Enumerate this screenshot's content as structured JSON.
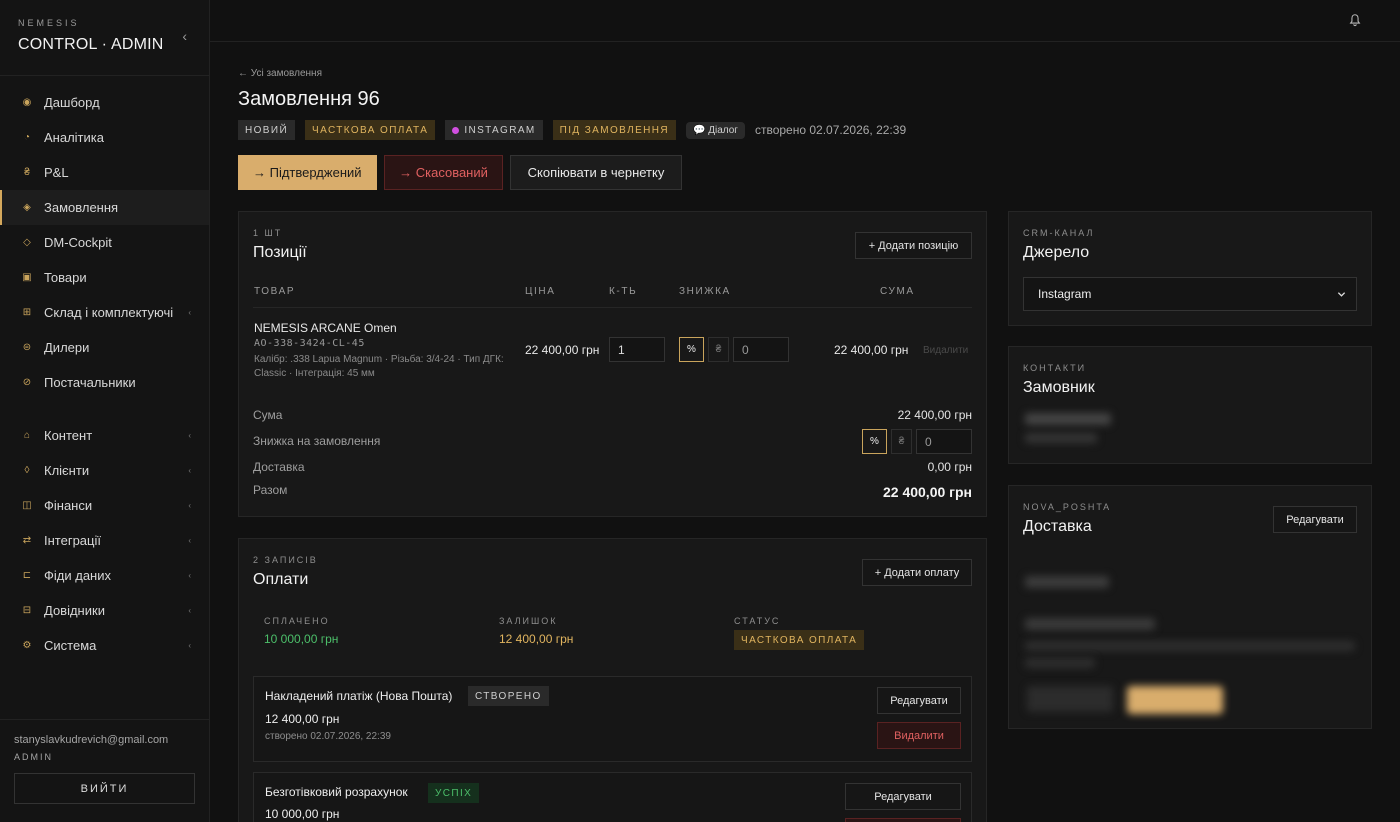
{
  "brand": {
    "sub": "NEMESIS",
    "title": "CONTROL · ADMIN",
    "collapse_icon": "‹"
  },
  "nav": {
    "group1": [
      {
        "label": "Дашборд",
        "icon": "◉"
      },
      {
        "label": "Аналітика",
        "icon": "◔"
      },
      {
        "label": "P&L",
        "icon": "₴"
      },
      {
        "label": "Замовлення",
        "icon": "◈"
      },
      {
        "label": "DM-Cockpit",
        "icon": "◇"
      },
      {
        "label": "Товари",
        "icon": "▣"
      },
      {
        "label": "Склад і комплектуючі",
        "icon": "⊞",
        "chev": "‹"
      },
      {
        "label": "Дилери",
        "icon": "⊜"
      },
      {
        "label": "Постачальники",
        "icon": "⊘"
      }
    ],
    "group2": [
      {
        "label": "Контент",
        "icon": "⌂",
        "chev": "‹"
      },
      {
        "label": "Клієнти",
        "icon": "◊",
        "chev": "‹"
      },
      {
        "label": "Фінанси",
        "icon": "◫",
        "chev": "‹"
      },
      {
        "label": "Інтеграції",
        "icon": "⇄",
        "chev": "‹"
      },
      {
        "label": "Фіди даних",
        "icon": "⊏",
        "chev": "‹"
      },
      {
        "label": "Довідники",
        "icon": "⊟",
        "chev": "‹"
      },
      {
        "label": "Система",
        "icon": "⚙",
        "chev": "‹"
      }
    ]
  },
  "user": {
    "email": "stanyslavkudrevich@gmail.com",
    "role": "ADMIN",
    "logout": "ВИЙТИ"
  },
  "order": {
    "back": "← Усі замовлення",
    "title": "Замовлення 96",
    "badges": {
      "new": "НОВИЙ",
      "payment": "ЧАСТКОВА ОПЛАТА",
      "channel": "INSTAGRAM",
      "order_type": "ПІД ЗАМОВЛЕННЯ",
      "dialog": "💬 Діалог"
    },
    "created": "створено 02.07.2026, 22:39",
    "actions": {
      "confirm": "→ Підтверджений",
      "cancel": "→ Скасований",
      "copy": "Скопіювати в чернетку"
    }
  },
  "positions": {
    "eyebrow": "1 ШТ",
    "title": "Позиції",
    "add_btn": "+ Додати позицію",
    "headers": {
      "product": "ТОВАР",
      "price": "ЦІНА",
      "qty": "К-ТЬ",
      "discount": "ЗНИЖКА",
      "sum": "СУМА"
    },
    "items": [
      {
        "name": "NEMESIS ARCANE Omen",
        "sku": "AO-338-3424-CL-45",
        "attrs_line1": "Калібр: .338 Lapua Magnum · Різьба: 3/4-24 · Тип ДГК:",
        "attrs_line2": "Classic · Інтеграція: 45 мм",
        "price": "22 400,00 грн",
        "qty": "1",
        "disc_pct": "%",
        "disc_cur": "₴",
        "disc_val": "0",
        "sum": "22 400,00 грн",
        "delete": "Видалити"
      }
    ],
    "totals": {
      "subtotal_label": "Сума",
      "subtotal": "22 400,00 грн",
      "discount_label": "Знижка на замовлення",
      "disc_pct": "%",
      "disc_cur": "₴",
      "disc_val": "0",
      "delivery_label": "Доставка",
      "delivery": "0,00 грн",
      "total_label": "Разом",
      "total": "22 400,00 грн"
    }
  },
  "payments": {
    "eyebrow": "2 ЗАПИСІВ",
    "title": "Оплати",
    "add_btn": "+ Додати оплату",
    "paid_label": "СПЛАЧЕНО",
    "paid": "10 000,00 грн",
    "rest_label": "ЗАЛИШОК",
    "rest": "12 400,00 грн",
    "status_label": "СТАТУС",
    "status": "ЧАСТКОВА ОПЛАТА",
    "records": [
      {
        "name": "Накладений платіж (Нова Пошта)",
        "badge": "СТВОРЕНО",
        "amount": "12 400,00 грн",
        "created": "створено 02.07.2026, 22:39",
        "edit": "Редагувати",
        "delete": "Видалити"
      },
      {
        "name": "Безготівковий розрахунок",
        "badge": "УСПІХ",
        "amount": "10 000,00 грн",
        "edit": "Редагувати"
      }
    ]
  },
  "source": {
    "eyebrow": "CRM-КАНАЛ",
    "title": "Джерело",
    "selected": "Instagram"
  },
  "contacts": {
    "eyebrow": "КОНТАКТИ",
    "title": "Замовник"
  },
  "delivery": {
    "eyebrow": "NOVA_POSHTA",
    "title": "Доставка",
    "edit": "Редагувати"
  },
  "colors": {
    "accent": "#d9ad6c",
    "success": "#4cbf6a",
    "warning": "#e0b45f",
    "danger": "#e06060"
  }
}
